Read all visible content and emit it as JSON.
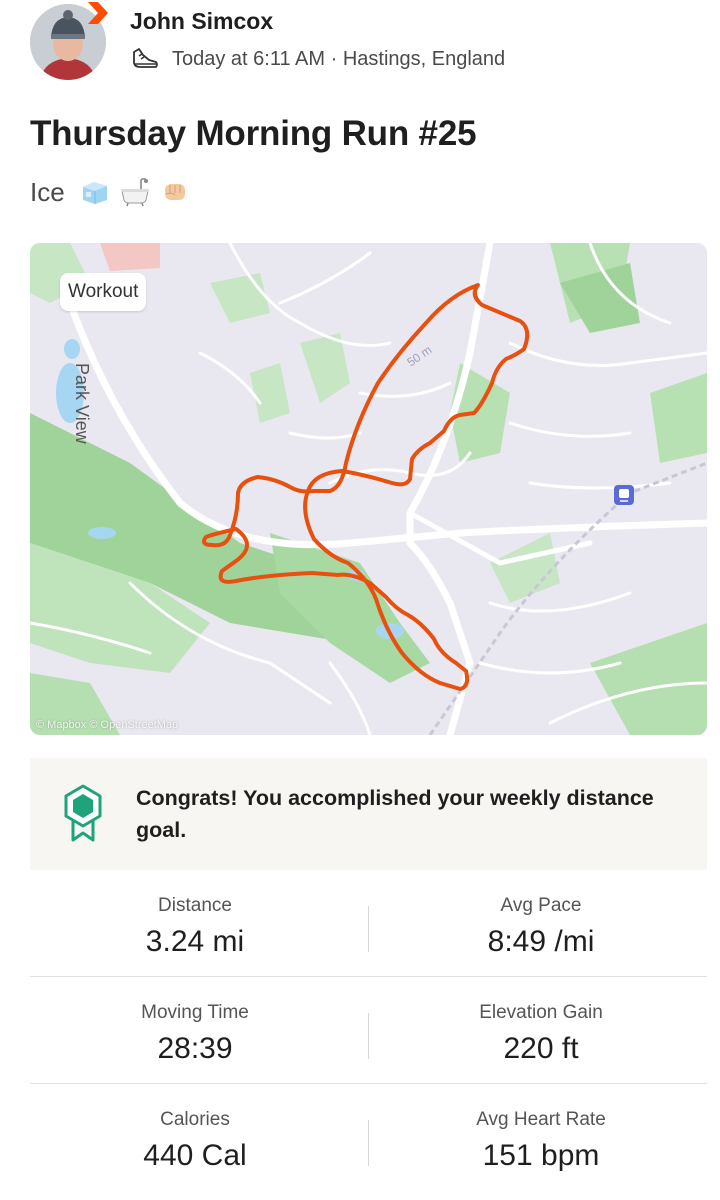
{
  "header": {
    "athlete_name": "John Simcox",
    "meta": "Today at 6:11 AM · Hastings, England",
    "badge_color": "#fc4c02"
  },
  "activity": {
    "title": "Thursday Morning Run #25",
    "description": "Ice",
    "description_emojis": [
      "ice-cube-icon",
      "bathtub-icon",
      "fist-bump-icon"
    ]
  },
  "map": {
    "chip_label": "Workout",
    "street_label": "Park View",
    "elevation_label": "50 m",
    "attribution": "© Mapbox © OpenStreetMap",
    "route_color": "#e8500f"
  },
  "goal": {
    "message": "Congrats! You accomplished your weekly distance goal.",
    "icon_color": "#1fa37a"
  },
  "stats": [
    {
      "left": {
        "label": "Distance",
        "value": "3.24 mi"
      },
      "right": {
        "label": "Avg Pace",
        "value": "8:49 /mi"
      }
    },
    {
      "left": {
        "label": "Moving Time",
        "value": "28:39"
      },
      "right": {
        "label": "Elevation Gain",
        "value": "220 ft"
      }
    },
    {
      "left": {
        "label": "Calories",
        "value": "440 Cal"
      },
      "right": {
        "label": "Avg Heart Rate",
        "value": "151 bpm"
      }
    }
  ]
}
